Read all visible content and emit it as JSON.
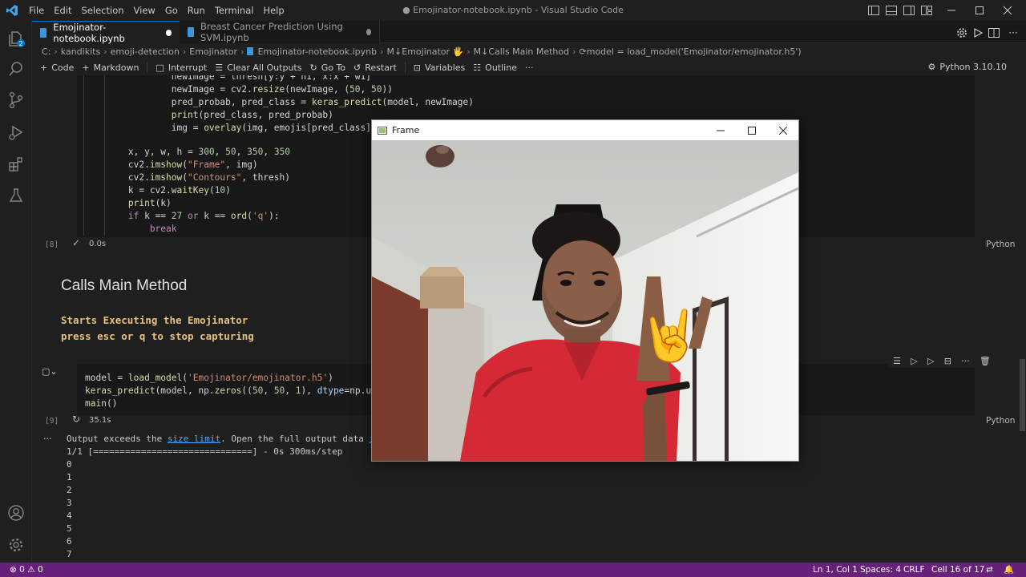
{
  "window": {
    "title": "● Emojinator-notebook.ipynb - Visual Studio Code"
  },
  "menu": [
    "File",
    "Edit",
    "Selection",
    "View",
    "Go",
    "Run",
    "Terminal",
    "Help"
  ],
  "tabs": [
    {
      "label": "Emojinator-notebook.ipynb",
      "active": true
    },
    {
      "label": "Breast Cancer Prediction Using SVM.ipynb",
      "active": false
    }
  ],
  "breadcrumb": [
    "C:",
    "kandikits",
    "emoji-detection",
    "Emojinator",
    "Emojinator-notebook.ipynb",
    "M↓Emojinator 🖐",
    "M↓Calls Main Method",
    "⟳model = load_model('Emojinator/emojinator.h5')"
  ],
  "toolbar": {
    "code": "Code",
    "markdown": "Markdown",
    "interrupt": "Interrupt",
    "clear_outputs": "Clear All Outputs",
    "goto": "Go To",
    "restart": "Restart",
    "variables": "Variables",
    "outline": "Outline",
    "more": "···",
    "kernel": "Python 3.10.10"
  },
  "cell8": {
    "exec_count": "[8]",
    "time": "0.0s",
    "lang": "Python",
    "lines": [
      "                newImage = thresh[y:y + h1, x:x + w1]",
      "                newImage = cv2.resize(newImage, (50, 50))",
      "                pred_probab, pred_class = keras_predict(model, newImage)",
      "                print(pred_class, pred_probab)",
      "                img = overlay(img, emojis[pred_class], 4",
      "",
      "        x, y, w, h = 300, 50, 350, 350",
      "        cv2.imshow(\"Frame\", img)",
      "        cv2.imshow(\"Contours\", thresh)",
      "        k = cv2.waitKey(10)",
      "        print(k)",
      "        if k == 27 or k == ord('q'):",
      "            break"
    ]
  },
  "markdown": {
    "heading": "Calls Main Method",
    "line1": "Starts Executing the Emojinator",
    "line2": "press esc or q to stop capturing"
  },
  "cell9": {
    "exec_count": "[9]",
    "time": "35.1s",
    "lang": "Python",
    "lines": [
      "model = load_model('Emojinator/emojinator.h5')",
      "keras_predict(model, np.zeros((50, 50, 1), dtype=np.uint",
      "main()"
    ]
  },
  "output": {
    "ellipsis": "···",
    "exceeds_prefix": "Output exceeds the ",
    "size_limit": "size limit",
    "exceeds_suffix": ". Open the full output data ",
    "in_link": "in",
    "progress": "1/1 [==============================] - 0s 300ms/step",
    "values": [
      "0",
      "1",
      "2",
      "3",
      "4",
      "5",
      "6",
      "7"
    ]
  },
  "frame": {
    "title": "Frame",
    "emoji": "🤘"
  },
  "status": {
    "errors": "0",
    "warnings": "0",
    "position": "Ln 1, Col 1",
    "spaces": "Spaces: 4",
    "eol": "CRLF",
    "cell": "Cell 16 of 17"
  },
  "colors": {
    "accent": "#0078d4",
    "statusbar": "#68217a",
    "markdown_text": "#e8c07a"
  }
}
